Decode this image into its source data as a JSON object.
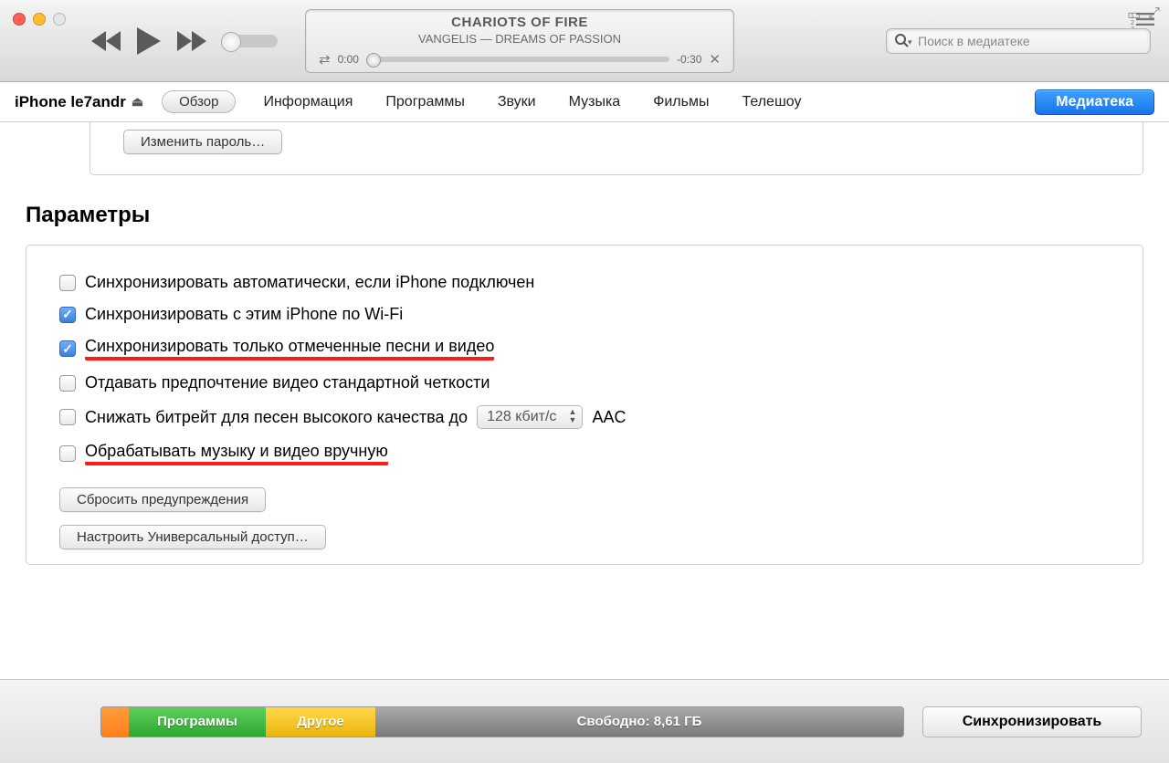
{
  "player": {
    "title": "CHARIOTS OF FIRE",
    "subtitle": "VANGELIS — DREAMS OF PASSION",
    "elapsed": "0:00",
    "remaining": "-0:30"
  },
  "search": {
    "placeholder": "Поиск в медиатеке"
  },
  "device_name": "iPhone le7andr",
  "tabs": {
    "overview": "Обзор",
    "info": "Информация",
    "apps": "Программы",
    "sounds": "Звуки",
    "music": "Музыка",
    "movies": "Фильмы",
    "tvshows": "Телешоу"
  },
  "library_button": "Медиатека",
  "change_password_btn": "Изменить пароль…",
  "section": "Параметры",
  "options": {
    "auto_sync": "Синхронизировать автоматически, если iPhone подключен",
    "wifi_sync": "Синхронизировать с этим iPhone по Wi-Fi",
    "checked_only": "Синхронизировать только отмеченные песни и видео",
    "prefer_sd": "Отдавать предпочтение видео стандартной четкости",
    "bitrate": "Снижать битрейт для песен высокого качества до",
    "bitrate_value": "128 кбит/с",
    "bitrate_codec": "AAC",
    "manual": "Обрабатывать музыку и видео вручную"
  },
  "buttons": {
    "reset_warnings": "Сбросить предупреждения",
    "accessibility": "Настроить Универсальный доступ…"
  },
  "capacity": {
    "apps_label": "Программы",
    "other_label": "Другое",
    "free_label": "Свободно: 8,61 ГБ"
  },
  "sync_button": "Синхронизировать"
}
